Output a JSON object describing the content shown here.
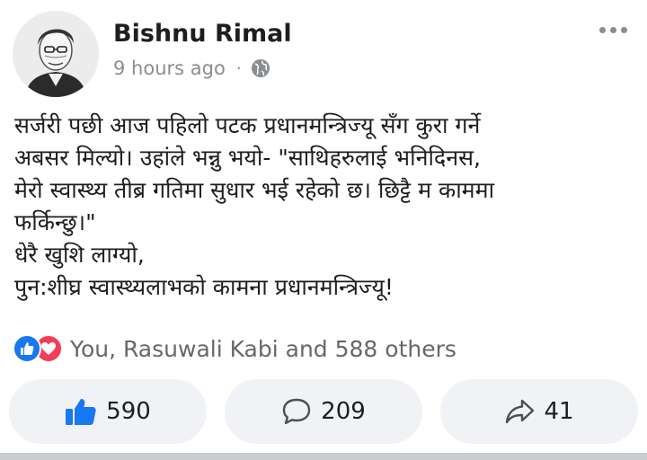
{
  "author": {
    "name": "Bishnu Rimal",
    "time": "9 hours ago",
    "dot": "·",
    "audience_icon": "globe-icon"
  },
  "post": {
    "lines": [
      "सर्जरी पछी आज पहिलो पटक प्रधानमन्त्रिज्यू सँग कुरा गर्ने",
      "अबसर मिल्यो। उहांले भन्नु भयो- \"साथिहरुलाई भनिदिनस,",
      "मेरो स्वास्थ्य तीब्र गतिमा सुधार भई रहेको छ। छिट्टै म काममा",
      "फर्किन्छु।\"",
      "धेरै खुशि लाग्यो,",
      "पुन:शीघ्र स्वास्थ्यलाभको कामना प्रधानमन्त्रिज्यू!"
    ]
  },
  "reactions": {
    "summary": "You, Rasuwali Kabi and 588 others",
    "icons": [
      "like-icon",
      "love-icon"
    ],
    "like_color": "#1877f2",
    "love_color": "#f33e58"
  },
  "actions": {
    "like_count": "590",
    "comment_count": "209",
    "share_count": "41"
  },
  "colors": {
    "accent": "#1877f2",
    "button_bg": "#f0f2f5",
    "muted_text": "#8a8d91"
  }
}
